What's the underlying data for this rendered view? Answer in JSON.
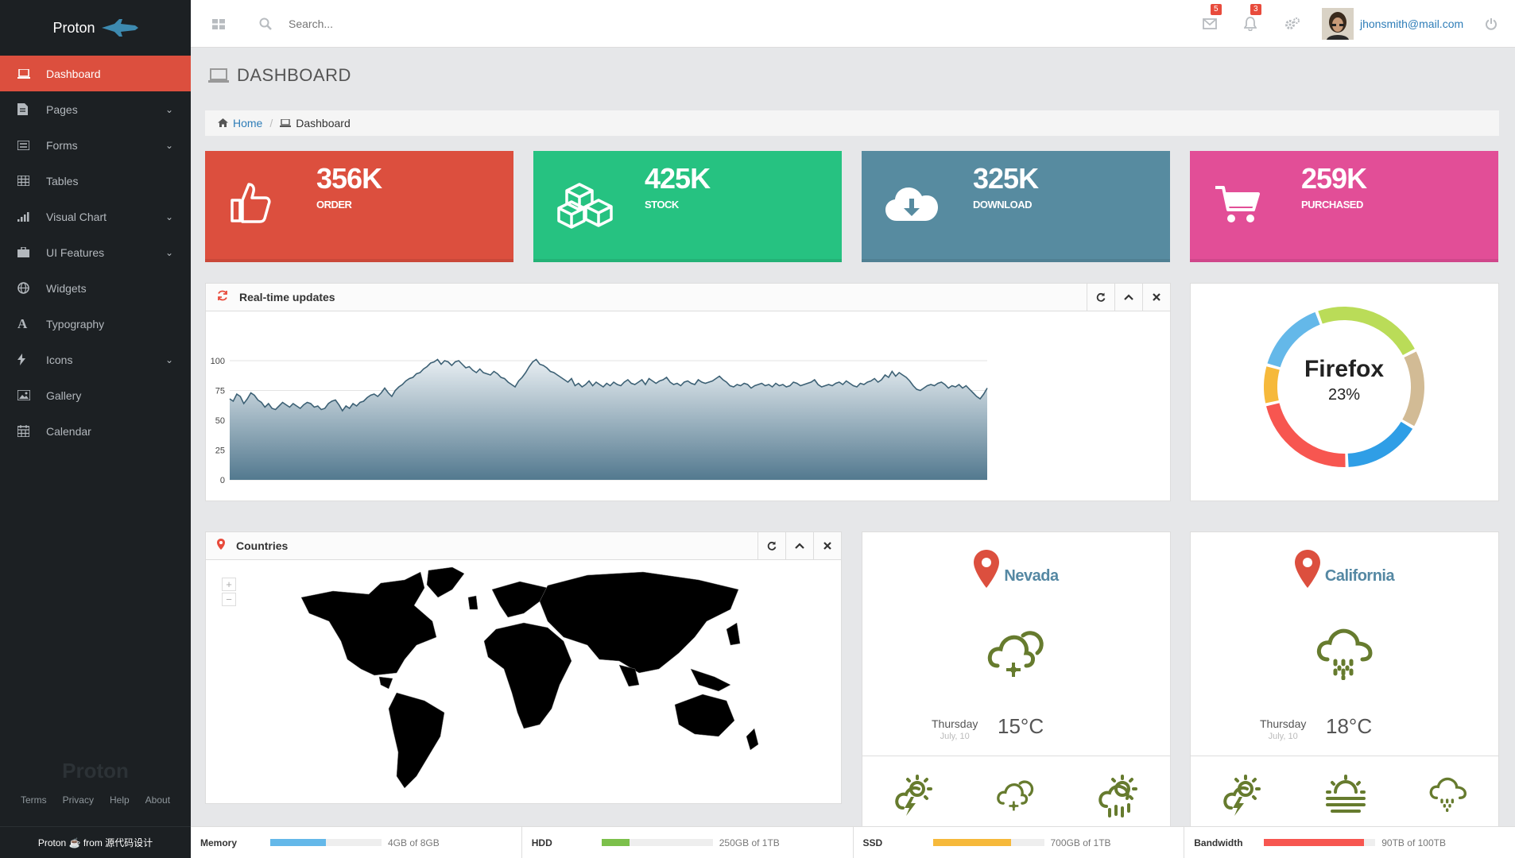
{
  "sidebar": {
    "brand": "Proton",
    "items": [
      {
        "label": "Dashboard",
        "icon": "laptop-icon",
        "active": true,
        "has_children": false
      },
      {
        "label": "Pages",
        "icon": "file-icon",
        "has_children": true
      },
      {
        "label": "Forms",
        "icon": "list-icon",
        "has_children": true
      },
      {
        "label": "Tables",
        "icon": "table-icon",
        "has_children": false
      },
      {
        "label": "Visual Chart",
        "icon": "bar-chart-icon",
        "has_children": true
      },
      {
        "label": "UI Features",
        "icon": "briefcase-icon",
        "has_children": true
      },
      {
        "label": "Widgets",
        "icon": "globe-icon",
        "has_children": false
      },
      {
        "label": "Typography",
        "icon": "font-icon",
        "has_children": false
      },
      {
        "label": "Icons",
        "icon": "bolt-icon",
        "has_children": true
      },
      {
        "label": "Gallery",
        "icon": "picture-icon",
        "has_children": false
      },
      {
        "label": "Calendar",
        "icon": "calendar-icon",
        "has_children": false
      }
    ],
    "footer_logo": "Proton",
    "footer_links": [
      "Terms",
      "Privacy",
      "Help",
      "About"
    ],
    "credit_name": "Proton",
    "credit_text": "from 源代码设计"
  },
  "topbar": {
    "search_placeholder": "Search...",
    "mail_count": "5",
    "notif_count": "3",
    "user_email": "jhonsmith@mail.com"
  },
  "page": {
    "title": "DASHBOARD",
    "breadcrumb": {
      "home": "Home",
      "current": "Dashboard"
    }
  },
  "stats": [
    {
      "value": "356K",
      "label": "ORDER",
      "color": "#dc4f3e",
      "icon": "thumbs-up-icon"
    },
    {
      "value": "425K",
      "label": "STOCK",
      "color": "#26c281",
      "icon": "cubes-icon"
    },
    {
      "value": "325K",
      "label": "DOWNLOAD",
      "color": "#578ba0",
      "icon": "cloud-download-icon"
    },
    {
      "value": "259K",
      "label": "PURCHASED",
      "color": "#e24e97",
      "icon": "shopping-cart-icon"
    }
  ],
  "realtime": {
    "title": "Real-time updates"
  },
  "countries": {
    "title": "Countries"
  },
  "chart_data": [
    {
      "type": "area",
      "title": "",
      "ylim": [
        0,
        100
      ],
      "yticks": [
        0,
        25,
        50,
        75,
        100
      ],
      "grid": true,
      "series": [
        {
          "values": [
            68,
            66,
            72,
            70,
            64,
            68,
            73,
            71,
            67,
            65,
            61,
            64,
            60,
            59,
            62,
            65,
            63,
            61,
            64,
            62,
            60,
            63,
            65,
            64,
            61,
            62,
            59,
            60,
            64,
            66,
            67,
            63,
            58,
            62,
            60,
            64,
            62,
            65,
            66,
            69,
            71,
            72,
            70,
            73,
            77,
            73,
            70,
            75,
            78,
            80,
            83,
            85,
            86,
            89,
            90,
            93,
            95,
            98,
            99,
            101,
            97,
            100,
            99,
            96,
            99,
            100,
            97,
            94,
            95,
            92,
            90,
            93,
            90,
            89,
            88,
            91,
            89,
            86,
            85,
            82,
            80,
            78,
            83,
            86,
            90,
            95,
            99,
            101,
            97,
            96,
            94,
            91,
            90,
            88,
            86,
            84,
            82,
            85,
            79,
            81,
            78,
            80,
            83,
            79,
            82,
            80,
            78,
            81,
            79,
            82,
            80,
            79,
            82,
            84,
            81,
            80,
            82,
            84,
            80,
            85,
            83,
            81,
            83,
            84,
            86,
            82,
            80,
            81,
            79,
            82,
            83,
            81,
            80,
            84,
            82,
            81,
            82,
            83,
            85,
            87,
            84,
            82,
            79,
            78,
            80,
            79,
            81,
            80,
            77,
            79,
            80,
            81,
            79,
            80,
            78,
            81,
            79,
            80,
            78,
            79,
            82,
            81,
            79,
            80,
            81,
            82,
            84,
            80,
            78,
            79,
            80,
            79,
            81,
            82,
            80,
            83,
            81,
            79,
            78,
            81,
            80,
            82,
            83,
            85,
            82,
            84,
            88,
            86,
            91,
            87,
            90,
            88,
            86,
            83,
            79,
            76,
            75,
            77,
            79,
            80,
            79,
            81,
            82,
            80,
            77,
            79,
            78,
            80,
            77,
            79,
            76,
            73,
            70,
            68,
            72,
            77
          ]
        }
      ]
    },
    {
      "type": "pie",
      "title": "",
      "center_label": "Firefox",
      "center_value": "23%",
      "slices": [
        {
          "value": 23,
          "color": "#badc58"
        },
        {
          "value": 16,
          "color": "#d2bb95"
        },
        {
          "value": 16,
          "color": "#2f9ee6"
        },
        {
          "value": 22,
          "color": "#f75650"
        },
        {
          "value": 8,
          "color": "#f6b93b"
        },
        {
          "value": 15,
          "color": "#64b8e9"
        }
      ]
    }
  ],
  "weather": [
    {
      "city": "Nevada",
      "day": "Thursday",
      "date": "July, 10",
      "temp": "15°C",
      "icon": "cloud-sun-snow-icon",
      "small_icons": [
        "sun-storm-icon",
        "cloud-sun-snow-icon",
        "sun-rain-icon"
      ]
    },
    {
      "city": "California",
      "day": "Thursday",
      "date": "July, 10",
      "temp": "18°C",
      "icon": "cloud-rain-icon",
      "small_icons": [
        "sun-storm-icon",
        "sun-fog-icon",
        "cloud-drizzle-icon"
      ]
    }
  ],
  "statusbar": [
    {
      "label": "Memory",
      "text": "4GB of 8GB",
      "fraction": 0.5,
      "color": "#64b8e9"
    },
    {
      "label": "HDD",
      "text": "250GB of 1TB",
      "fraction": 0.25,
      "color": "#7cc04b"
    },
    {
      "label": "SSD",
      "text": "700GB of 1TB",
      "fraction": 0.7,
      "color": "#f6b93b"
    },
    {
      "label": "Bandwidth",
      "text": "90TB of 100TB",
      "fraction": 0.9,
      "color": "#f75650"
    }
  ]
}
